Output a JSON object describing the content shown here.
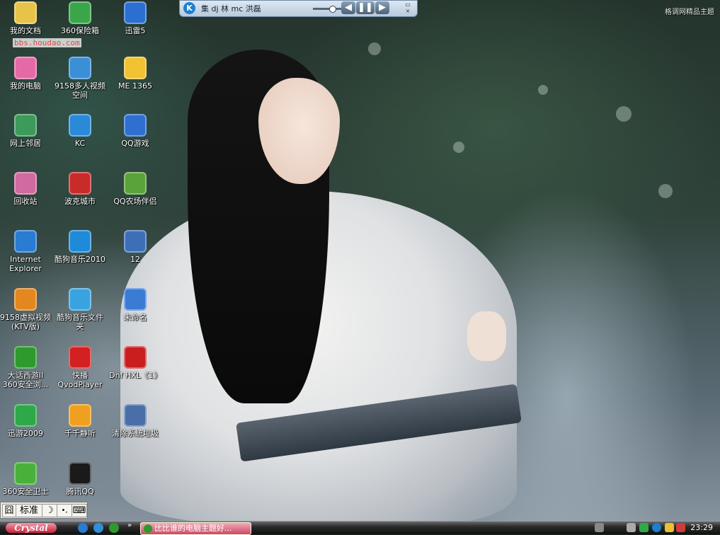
{
  "wallpaper": {
    "theme_title": "格调网精品主题"
  },
  "watermark": {
    "site": "bbs.houdao.com"
  },
  "player": {
    "logo_letter": "K",
    "song": "集 dj 林 mc 洪磊",
    "volume_level": 0.45,
    "prev": "◀",
    "pause": "❚❚",
    "next": "▶",
    "mini": "▭\n×"
  },
  "desktop_icons": [
    {
      "label": "我的文档",
      "icon": "folder-doc-icon",
      "color": "#e8c34a"
    },
    {
      "label": "360保险箱",
      "icon": "safe-icon",
      "color": "#3aa64a"
    },
    {
      "label": "迅雷5",
      "icon": "thunder-icon",
      "color": "#2a6fd1"
    },
    {
      "label": "我的电脑",
      "icon": "computer-icon",
      "color": "#e46aa7"
    },
    {
      "label": "9158多人视频\n空间",
      "icon": "video-chat-icon",
      "color": "#3a8fd6"
    },
    {
      "label": "ME 1365",
      "icon": "folder-icon",
      "color": "#f1c232"
    },
    {
      "label": "网上邻居",
      "icon": "network-icon",
      "color": "#3c9a5a"
    },
    {
      "label": "KC",
      "icon": "kc-icon",
      "color": "#2a8ad8"
    },
    {
      "label": "QQ游戏",
      "icon": "qq-game-icon",
      "color": "#2f6fd0"
    },
    {
      "label": "回收站",
      "icon": "recycle-bin-icon",
      "color": "#d06aa0"
    },
    {
      "label": "波克城市",
      "icon": "poker-city-icon",
      "color": "#c92a2a"
    },
    {
      "label": "QQ农场伴侣",
      "icon": "qq-farm-icon",
      "color": "#5aa23a"
    },
    {
      "label": "Internet\nExplorer",
      "icon": "ie-icon",
      "color": "#2a7bd2"
    },
    {
      "label": "酷狗音乐2010",
      "icon": "kugou-icon",
      "color": "#1f8ad8"
    },
    {
      "label": "12",
      "icon": "image-file-icon",
      "color": "#3c6fb8"
    },
    {
      "label": "9158虚拟视频\n(KTV版)",
      "icon": "virtual-video-icon",
      "color": "#e3871e"
    },
    {
      "label": "酷狗音乐文件\n夹",
      "icon": "kugou-folder-icon",
      "color": "#39a3e0"
    },
    {
      "label": "未命名",
      "icon": "unnamed-file-icon",
      "color": "#3a7bd5"
    },
    {
      "label": "大话西游II\n360安全浏...",
      "icon": "browser-360-icon",
      "color": "#2e9a2e"
    },
    {
      "label": "快播\nQvodPlayer",
      "icon": "qvod-icon",
      "color": "#d32020"
    },
    {
      "label": "Dnf HXL《1》",
      "icon": "crossfire-icon",
      "color": "#c81e1e"
    },
    {
      "label": "迅游2009",
      "icon": "xunyou-icon",
      "color": "#2fa84a"
    },
    {
      "label": "千千静听",
      "icon": "ttplayer-icon",
      "color": "#f0a020"
    },
    {
      "label": "清除系统垃圾",
      "icon": "cleanup-icon",
      "color": "#4a6fa8"
    },
    {
      "label": "360安全卫士",
      "icon": "shield-icon",
      "color": "#4ab03a"
    },
    {
      "label": "腾讯QQ",
      "icon": "qq-icon",
      "color": "#1a1a1a"
    }
  ],
  "ime": {
    "mode": "标准",
    "moon": "☽",
    "punct": "•,",
    "keyboard": "⌨"
  },
  "taskbar": {
    "start_label": "Crystal",
    "more": "»",
    "task_label": "比比谁的电脑主题好...",
    "clock": "23:29"
  }
}
